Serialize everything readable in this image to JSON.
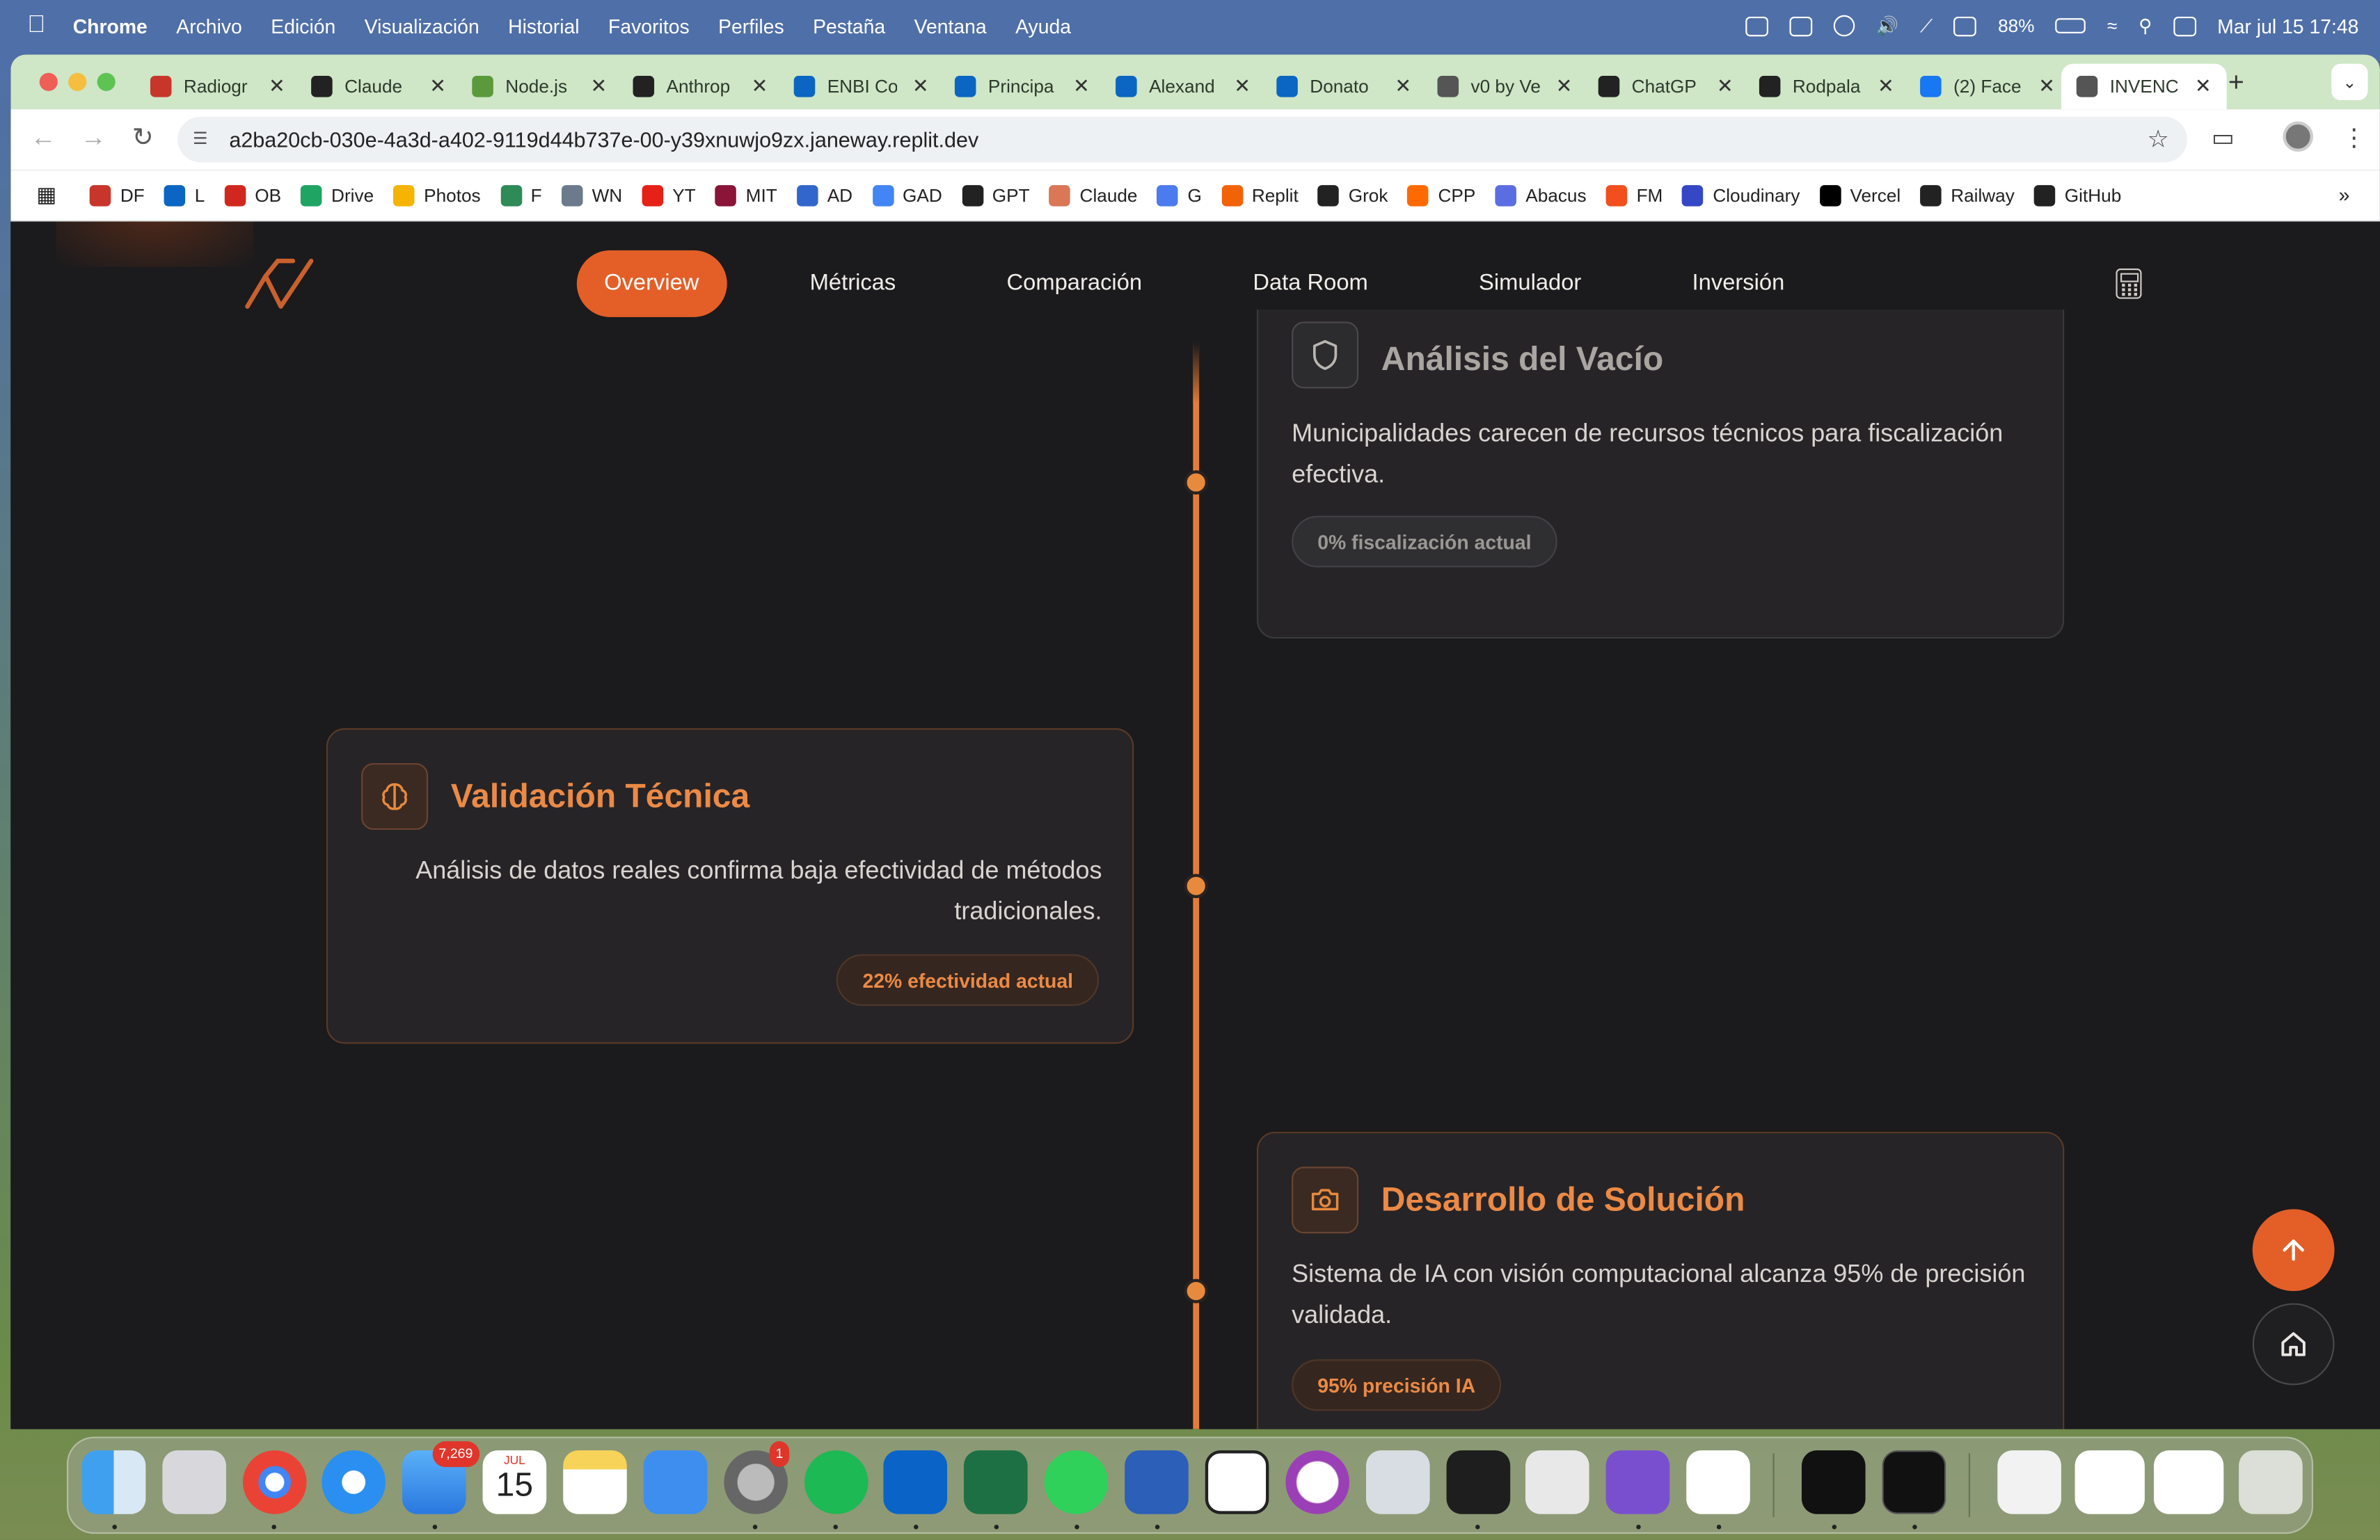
{
  "menubar": {
    "app": "Chrome",
    "items": [
      "Archivo",
      "Edición",
      "Visualización",
      "Historial",
      "Favoritos",
      "Perfiles",
      "Pestaña",
      "Ventana",
      "Ayuda"
    ],
    "battery": "88%",
    "datetime": "Mar jul 15  17:48"
  },
  "tabs": [
    {
      "title": "Radiogr",
      "icon_color": "#c8362b"
    },
    {
      "title": "Claude",
      "icon_color": "#222222"
    },
    {
      "title": "Node.js",
      "icon_color": "#5a9a3c"
    },
    {
      "title": "Anthrop",
      "icon_color": "#222222"
    },
    {
      "title": "ENBI Co",
      "icon_color": "#0a66c2"
    },
    {
      "title": "Principa",
      "icon_color": "#0a66c2"
    },
    {
      "title": "Alexand",
      "icon_color": "#0a66c2"
    },
    {
      "title": "Donato",
      "icon_color": "#0a66c2"
    },
    {
      "title": "v0 by Ve",
      "icon_color": "#555555"
    },
    {
      "title": "ChatGP",
      "icon_color": "#222222"
    },
    {
      "title": "Rodpala",
      "icon_color": "#222222"
    },
    {
      "title": "(2) Face",
      "icon_color": "#1877f2"
    },
    {
      "title": "INVENC",
      "icon_color": "#555555"
    }
  ],
  "url": "a2ba20cb-030e-4a3d-a402-9119d44b737e-00-y39xnuwjo9zx.janeway.replit.dev",
  "bookmarks": [
    {
      "label": "DF",
      "color": "#c8362b"
    },
    {
      "label": "L",
      "color": "#0a66c2"
    },
    {
      "label": "OB",
      "color": "#d0281e"
    },
    {
      "label": "Drive",
      "color": "#1fa463"
    },
    {
      "label": "Photos",
      "color": "#f4b400"
    },
    {
      "label": "F",
      "color": "#2e8b57"
    },
    {
      "label": "WN",
      "color": "#6b7b8c"
    },
    {
      "label": "YT",
      "color": "#e62117"
    },
    {
      "label": "MIT",
      "color": "#8a1538"
    },
    {
      "label": "AD",
      "color": "#3366cc"
    },
    {
      "label": "GAD",
      "color": "#4285f4"
    },
    {
      "label": "GPT",
      "color": "#222222"
    },
    {
      "label": "Claude",
      "color": "#d97757"
    },
    {
      "label": "G",
      "color": "#4b7bec"
    },
    {
      "label": "Replit",
      "color": "#f26207"
    },
    {
      "label": "Grok",
      "color": "#222222"
    },
    {
      "label": "CPP",
      "color": "#ff6a00"
    },
    {
      "label": "Abacus",
      "color": "#5b6ee1"
    },
    {
      "label": "FM",
      "color": "#f24e1e"
    },
    {
      "label": "Cloudinary",
      "color": "#3448c5"
    },
    {
      "label": "Vercel",
      "color": "#000000"
    },
    {
      "label": "Railway",
      "color": "#222222"
    },
    {
      "label": "GitHub",
      "color": "#222222"
    }
  ],
  "nav": {
    "items": [
      "Overview",
      "Métricas",
      "Comparación",
      "Data Room",
      "Simulador",
      "Inversión"
    ],
    "active": "Overview"
  },
  "cards": [
    {
      "title": "Análisis del Vacío",
      "icon": "shield-icon",
      "description": "Municipalidades carecen de recursos técnicos para fiscalización efectiva.",
      "badge": "0% fiscalización actual"
    },
    {
      "title": "Validación Técnica",
      "icon": "brain-icon",
      "description": "Análisis de datos reales confirma baja efectividad de métodos tradicionales.",
      "badge": "22% efectividad actual"
    },
    {
      "title": "Desarrollo de Solución",
      "icon": "camera-icon",
      "description": "Sistema de IA con visión computacional alcanza 95% de precisión validada.",
      "badge": "95% precisión IA"
    }
  ],
  "colors": {
    "accent": "#e35f27",
    "timeline": "#e67c33",
    "background": "#1b1a1c",
    "card": "#262427",
    "title_active": "#ec8a45",
    "title_dim": "#a9a6a2"
  },
  "dock": {
    "mail_badge": "7,269",
    "calendar_month": "JUL",
    "calendar_day": "15",
    "settings_badge": "1"
  }
}
